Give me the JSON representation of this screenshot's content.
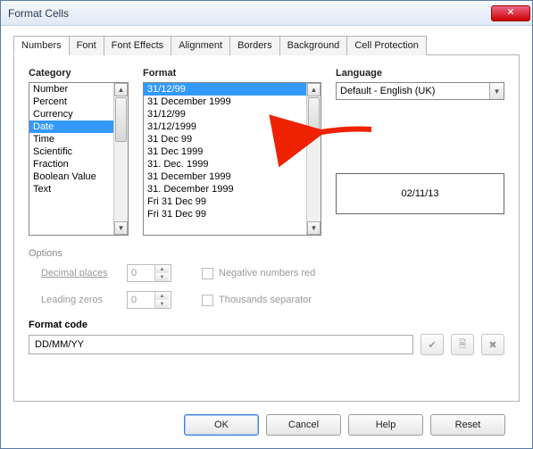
{
  "window": {
    "title": "Format Cells"
  },
  "tabs": [
    {
      "label": "Numbers",
      "active": true
    },
    {
      "label": "Font",
      "active": false
    },
    {
      "label": "Font Effects",
      "active": false
    },
    {
      "label": "Alignment",
      "active": false
    },
    {
      "label": "Borders",
      "active": false
    },
    {
      "label": "Background",
      "active": false
    },
    {
      "label": "Cell Protection",
      "active": false
    }
  ],
  "labels": {
    "category": "Category",
    "format": "Format",
    "language": "Language",
    "options": "Options",
    "decimal_places": "Decimal places",
    "leading_zeros": "Leading zeros",
    "neg_red": "Negative numbers red",
    "thousands": "Thousands separator",
    "format_code": "Format code"
  },
  "category": {
    "items": [
      "Number",
      "Percent",
      "Currency",
      "Date",
      "Time",
      "Scientific",
      "Fraction",
      "Boolean Value",
      "Text"
    ],
    "selected_index": 3
  },
  "format": {
    "items": [
      "31/12/99",
      "31 December 1999",
      "31/12/99",
      "31/12/1999",
      "31 Dec 99",
      "31 Dec 1999",
      "31. Dec. 1999",
      "31 December 1999",
      "31. December 1999",
      "Fri 31 Dec 99",
      "Fri 31 Dec 99"
    ],
    "selected_index": 0
  },
  "language": {
    "value": "Default - English (UK)"
  },
  "preview": {
    "value": "02/11/13"
  },
  "options": {
    "decimal_places": "0",
    "leading_zeros": "0",
    "neg_red_checked": false,
    "thousands_checked": false,
    "enabled": false
  },
  "format_code": {
    "value": "DD/MM/YY"
  },
  "buttons": {
    "ok": "OK",
    "cancel": "Cancel",
    "help": "Help",
    "reset": "Reset"
  }
}
